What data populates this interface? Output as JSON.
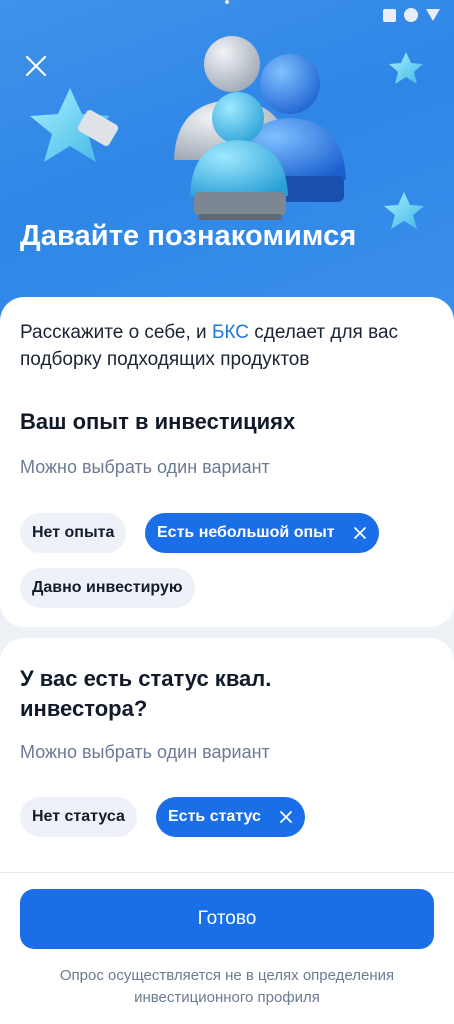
{
  "hero": {
    "title": "Давайте познакомимся"
  },
  "intro": {
    "prefix": "Расскажите о себе, и ",
    "brand": "БКС",
    "suffix": " сделает для вас подборку подходящих продуктов"
  },
  "question1": {
    "title": "Ваш опыт в инвестициях",
    "hint": "Можно выбрать один вариант",
    "options": [
      "Нет опыта",
      "Есть небольшой опыт",
      "Давно инвестирую"
    ],
    "selected": "Есть небольшой опыт"
  },
  "question2": {
    "title": "У вас есть статус квал. инвестора?",
    "hint": "Можно выбрать один вариант",
    "options": [
      "Нет статуса",
      "Есть статус"
    ],
    "selected": "Есть статус"
  },
  "footer": {
    "done_label": "Готово",
    "disclaimer": "Опрос осуществляется не в целях определения инвестиционного профиля"
  },
  "colors": {
    "accent": "#1a6fe8",
    "hero_bg": "#3a8fe9",
    "brand_text": "#1f74e6"
  },
  "icons": [
    "close-icon",
    "chip-remove-icon",
    "star-illustration",
    "people-illustration"
  ]
}
